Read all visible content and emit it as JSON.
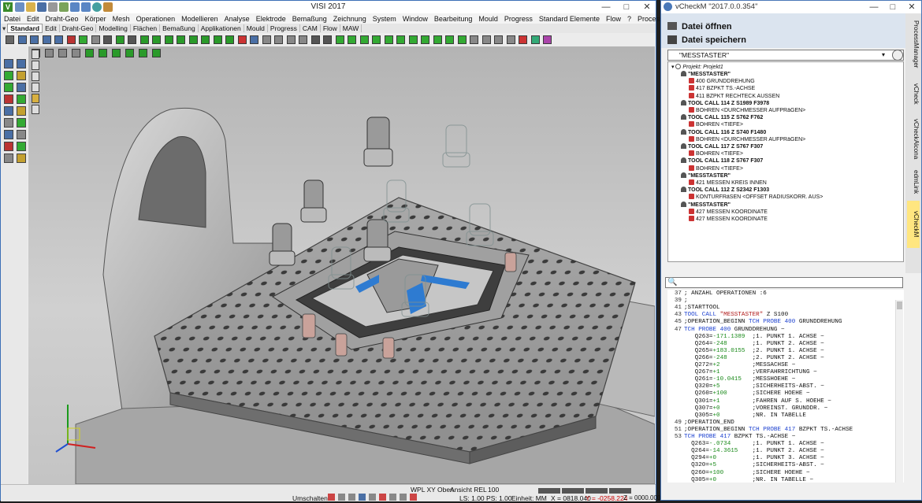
{
  "visi": {
    "title": "VISI 2017",
    "logo": "V",
    "menu": [
      "Datei",
      "Edit",
      "Draht-Geo",
      "Körper",
      "Mesh",
      "Operationen",
      "Modellieren",
      "Analyse",
      "Elektrode",
      "Bemaßung",
      "Zeichnung",
      "System",
      "Window",
      "Bearbeitung",
      "Mould",
      "Progress",
      "Standard Elemente",
      "Flow",
      "?",
      "ProcessManager"
    ],
    "tabs": [
      "Standard",
      "Edit",
      "Draht-Geo",
      "Modelling",
      "Flächen",
      "Bemaßung",
      "Applikationen",
      "Mould",
      "Progress",
      "CAM",
      "Flow",
      "MAW"
    ],
    "active_tab": "Standard",
    "status": {
      "umschalten": "Umschalten",
      "wpl": "WPL XY Oben",
      "ansicht": "Ansicht REL",
      "zoom": "100",
      "ls": "LS: 1.00 PS: 1.00",
      "einheit": "Einheit: MM",
      "x": "X = 0818.040",
      "y": "Y = -0258.224",
      "z": "Z = 0000.000"
    }
  },
  "vcheck": {
    "title": "vCheckM \"2017.0.0.354\"",
    "open_label": "Datei öffnen",
    "save_label": "Datei speichern",
    "combo_value": "\"MESSTASTER\"",
    "side_tabs": [
      "ProcessManager",
      "vCheck",
      "vCheckAlcona",
      "edmLink",
      "vCheckM"
    ],
    "active_side_tab": "vCheckM",
    "tree_root": "Projekt: Projekt1",
    "tree": [
      {
        "label": "\"MESSTASTER\"",
        "bold": true,
        "depth": 1,
        "icon": "tool"
      },
      {
        "label": "400 GRUNDDREHUNG",
        "bold": false,
        "depth": 2,
        "icon": "op"
      },
      {
        "label": "417 BZPKT TS.-ACHSE",
        "bold": false,
        "depth": 2,
        "icon": "op"
      },
      {
        "label": "411 BZPKT RECHTECK AUSSEN",
        "bold": false,
        "depth": 2,
        "icon": "op"
      },
      {
        "label": "TOOL CALL 114 Z S1989 F3978",
        "bold": true,
        "depth": 1,
        "icon": "tool"
      },
      {
        "label": "BOHREN <DURCHMESSER AUFPRäGEN>",
        "bold": false,
        "depth": 2,
        "icon": "op"
      },
      {
        "label": "TOOL CALL 115 Z S762 F762",
        "bold": true,
        "depth": 1,
        "icon": "tool"
      },
      {
        "label": "BOHREN <TIEFE>",
        "bold": false,
        "depth": 2,
        "icon": "op"
      },
      {
        "label": "TOOL CALL 116 Z S740 F1480",
        "bold": true,
        "depth": 1,
        "icon": "tool"
      },
      {
        "label": "BOHREN <DURCHMESSER AUFPRäGEN>",
        "bold": false,
        "depth": 2,
        "icon": "op"
      },
      {
        "label": "TOOL CALL 117 Z S767 F307",
        "bold": true,
        "depth": 1,
        "icon": "tool"
      },
      {
        "label": "BOHREN <TIEFE>",
        "bold": false,
        "depth": 2,
        "icon": "op"
      },
      {
        "label": "TOOL CALL 118 Z S767 F307",
        "bold": true,
        "depth": 1,
        "icon": "tool"
      },
      {
        "label": "BOHREN <TIEFE>",
        "bold": false,
        "depth": 2,
        "icon": "op"
      },
      {
        "label": "\"MESSTASTER\"",
        "bold": true,
        "depth": 1,
        "icon": "tool"
      },
      {
        "label": "421 MESSEN KREIS INNEN",
        "bold": false,
        "depth": 2,
        "icon": "op"
      },
      {
        "label": "TOOL CALL 112 Z S2342 F1303",
        "bold": true,
        "depth": 1,
        "icon": "tool"
      },
      {
        "label": "KONTURFRäSEN <OFFSET RADIUSKORR. AUS>",
        "bold": false,
        "depth": 2,
        "icon": "op"
      },
      {
        "label": "\"MESSTASTER\"",
        "bold": true,
        "depth": 1,
        "icon": "tool"
      },
      {
        "label": "427 MESSEN KOORDINATE",
        "bold": false,
        "depth": 2,
        "icon": "op"
      },
      {
        "label": "427 MESSEN KOORDINATE",
        "bold": false,
        "depth": 2,
        "icon": "op"
      }
    ],
    "code": [
      {
        "n": "37",
        "t": "; ANZAHL OPERATIONEN :6"
      },
      {
        "n": "39",
        "t": ";"
      },
      {
        "n": "41",
        "t": ";STARTTOOL"
      },
      {
        "n": "43",
        "t": "TOOL CALL \"MESSTASTER\" Z S100"
      },
      {
        "n": "45",
        "t": ";OPERATION_BEGINN TCH PROBE 400 GRUNDDREHUNG"
      },
      {
        "n": "47",
        "t": "TCH PROBE 400 GRUNDDREHUNG ~"
      },
      {
        "n": "",
        "t": "   Q263=-171.1389  ;1. PUNKT 1. ACHSE ~"
      },
      {
        "n": "",
        "t": "   Q264=-248       ;1. PUNKT 2. ACHSE ~"
      },
      {
        "n": "",
        "t": "   Q265=+183.0155  ;2. PUNKT 1. ACHSE ~"
      },
      {
        "n": "",
        "t": "   Q266=-248       ;2. PUNKT 2. ACHSE ~"
      },
      {
        "n": "",
        "t": "   Q272=+2         ;MESSACHSE ~"
      },
      {
        "n": "",
        "t": "   Q267=+1         ;VERFAHRRICHTUNG ~"
      },
      {
        "n": "",
        "t": "   Q261=-10.0415   ;MESSHOEHE ~"
      },
      {
        "n": "",
        "t": "   Q320=+5         ;SICHERHEITS-ABST. ~"
      },
      {
        "n": "",
        "t": "   Q260=+100       ;SICHERE HOEHE ~"
      },
      {
        "n": "",
        "t": "   Q301=+1         ;FAHREN AUF S. HOEHE ~"
      },
      {
        "n": "",
        "t": "   Q307=+0         ;VOREINST. GRUNDDR. ~"
      },
      {
        "n": "",
        "t": "   Q305=+0         ;NR. IN TABELLE"
      },
      {
        "n": "49",
        "t": ";OPERATION_END"
      },
      {
        "n": "51",
        "t": ";OPERATION_BEGINN TCH PROBE 417 BZPKT TS.-ACHSE"
      },
      {
        "n": "53",
        "t": "TCH PROBE 417 BZPKT TS.-ACHSE ~"
      },
      {
        "n": "",
        "t": "  Q263=-.0734      ;1. PUNKT 1. ACHSE ~"
      },
      {
        "n": "",
        "t": "  Q264=-14.3615    ;1. PUNKT 2. ACHSE ~"
      },
      {
        "n": "",
        "t": "  Q294=+0          ;1. PUNKT 3. ACHSE ~"
      },
      {
        "n": "",
        "t": "  Q320=+5          ;SICHERHEITS-ABST. ~"
      },
      {
        "n": "",
        "t": "  Q260=+100        ;SICHERE HOEHE ~"
      },
      {
        "n": "",
        "t": "  Q305=+0          ;NR. IN TABELLE ~"
      }
    ]
  },
  "colors": {
    "accent": "#3b6fb6",
    "keyword": "#1a3fcf",
    "string": "#b01818",
    "number": "#1a8a1a",
    "active_tab": "#ffe680"
  }
}
